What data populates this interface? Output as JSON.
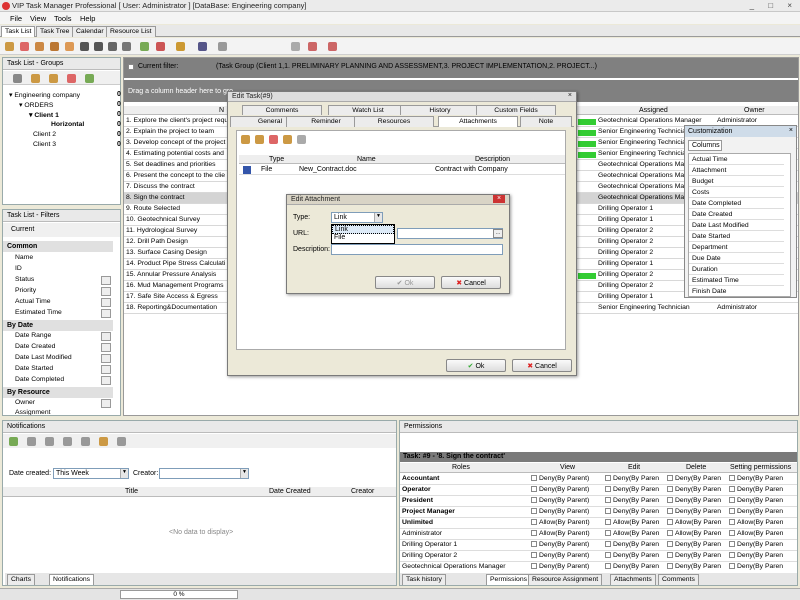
{
  "app": {
    "title": "VIP Task Manager Professional [ User: Administrator ] [DataBase: Engineering company]",
    "win_buttons": "_ □ ×"
  },
  "menu": [
    "File",
    "View",
    "Tools",
    "Help"
  ],
  "tabs": [
    "Task List",
    "Task Tree",
    "Calendar",
    "Resource List"
  ],
  "groups": {
    "title": "Task List - Groups",
    "tree": [
      {
        "label": "Engineering company",
        "count": "0"
      },
      {
        "label": "ORDERS",
        "count": "0"
      },
      {
        "label": "Client 1",
        "count": "0"
      },
      {
        "label": "Horizontal",
        "count": "0"
      },
      {
        "label": "Client 2",
        "count": "0"
      },
      {
        "label": "Client 3",
        "count": "0"
      }
    ]
  },
  "filters": {
    "title": "Task List - Filters",
    "current": "Current",
    "sections": [
      {
        "name": "Common",
        "items": [
          "Name",
          "ID",
          "Status",
          "Priority",
          "Actual Time",
          "Estimated Time"
        ]
      },
      {
        "name": "By Date",
        "items": [
          "Date Range",
          "Date Created",
          "Date Last Modified",
          "Date Started",
          "Date Completed"
        ]
      },
      {
        "name": "By Resource",
        "items": [
          "Owner",
          "Assignment"
        ]
      }
    ]
  },
  "main": {
    "current_filter_label": "Current filter:",
    "current_filter_value": "(Task Group (Client 1,1. PRELIMINARY PLANNING AND ASSESSMENT,3. PROJECT IMPLEMENTATION,2. PROJECT...)",
    "drag_hint": "Drag a column header here to gro",
    "col_name": "N",
    "col_assigned": "Assigned",
    "col_owner": "Owner",
    "rows": [
      {
        "name": "1. Explore the client's project requ",
        "assigned": "Geotechnical Operations Manager",
        "owner": "Administrator"
      },
      {
        "name": "2. Explain the project to team",
        "assigned": "Senior Engineering Technician",
        "owner": "Administrator"
      },
      {
        "name": "3. Develop concept of the project",
        "assigned": "Senior Engineering Technician",
        "owner": "Administrator"
      },
      {
        "name": "4. Estimating potential costs and",
        "assigned": "Senior Engineering Technician",
        "owner": "Administrator"
      },
      {
        "name": "5. Set deadlines and priorities",
        "assigned": "Geotechnical Operations Mana",
        "owner": ""
      },
      {
        "name": "6. Present the concept to the clie",
        "assigned": "Geotechnical Operations Mana",
        "owner": ""
      },
      {
        "name": "7. Discuss the contract",
        "assigned": "Geotechnical Operations Mana",
        "owner": ""
      },
      {
        "name": "8. Sign the contract",
        "assigned": "Geotechnical Operations Mana",
        "owner": ""
      },
      {
        "name": "9. Route Selected",
        "assigned": "Drilling Operator 1",
        "owner": ""
      },
      {
        "name": "10. Geotechnical Survey",
        "assigned": "Drilling Operator 1",
        "owner": ""
      },
      {
        "name": "11. Hydrological Survey",
        "assigned": "Drilling Operator 2",
        "owner": ""
      },
      {
        "name": "12. Drill Path Design",
        "assigned": "Drilling Operator 2",
        "owner": ""
      },
      {
        "name": "13. Surface Casing Design",
        "assigned": "Drilling Operator 2",
        "owner": ""
      },
      {
        "name": "14. Product Pipe Stress Calculati",
        "assigned": "Drilling Operator 1",
        "owner": ""
      },
      {
        "name": "15. Annular Pressure Analysis",
        "assigned": "Drilling Operator 2",
        "owner": ""
      },
      {
        "name": "16. Mud Management Programs",
        "assigned": "Drilling Operator 2",
        "owner": ""
      },
      {
        "name": "17. Safe Site Access & Egress",
        "assigned": "Drilling Operator 1",
        "owner": ""
      },
      {
        "name": "18. Reporting&Documentation",
        "assigned": "Senior Engineering Technician",
        "owner": "Administrator"
      }
    ]
  },
  "edit_task": {
    "title": "Edit Task(#9)",
    "tabs_row1": [
      "Comments",
      "Watch List",
      "History",
      "Custom Fields"
    ],
    "tabs_row2": [
      "General",
      "Reminder",
      "Resources",
      "Attachments",
      "Note"
    ],
    "att_cols": {
      "type": "Type",
      "name": "Name",
      "desc": "Description"
    },
    "attachment": {
      "type": "File",
      "name": "New_Contract.doc",
      "desc": "Contract with Company"
    },
    "ok": "Ok",
    "cancel": "Cancel"
  },
  "edit_attachment": {
    "title": "Edit Attachment",
    "type_label": "Type:",
    "type_value": "Link",
    "options": [
      "Link",
      "File"
    ],
    "url_label": "URL:",
    "desc_label": "Description:",
    "ok": "Ok",
    "cancel": "Cancel"
  },
  "customization": {
    "title": "Customization",
    "tab": "Columns",
    "items": [
      "Actual Time",
      "Attachment",
      "Budget",
      "Costs",
      "Date Completed",
      "Date Created",
      "Date Last Modified",
      "Date Started",
      "Department",
      "Due Date",
      "Duration",
      "Estimated Time",
      "Finish Date"
    ]
  },
  "notifications": {
    "title": "Notifications",
    "date_label": "Date created:",
    "date_value": "This Week",
    "creator_label": "Creator:",
    "col_title": "Title",
    "col_date": "Date Created",
    "col_creator": "Creator",
    "empty": "<No data to display>",
    "tabs": [
      "Charts",
      "Notifications"
    ]
  },
  "permissions": {
    "title": "Permissions",
    "task": "Task: #9 - '8. Sign the contract'",
    "cols": [
      "Roles",
      "View",
      "Edit",
      "Delete",
      "Setting permissions"
    ],
    "rows": [
      {
        "role": "Accountant",
        "bold": true,
        "v": "Deny(By Parent)",
        "e": "Deny(By Paren",
        "d": "Deny(By Paren",
        "s": "Deny(By Paren"
      },
      {
        "role": "Operator",
        "bold": true,
        "v": "Deny(By Parent)",
        "e": "Deny(By Paren",
        "d": "Deny(By Paren",
        "s": "Deny(By Paren"
      },
      {
        "role": "President",
        "bold": true,
        "v": "Deny(By Parent)",
        "e": "Deny(By Paren",
        "d": "Deny(By Paren",
        "s": "Deny(By Paren"
      },
      {
        "role": "Project Manager",
        "bold": true,
        "v": "Deny(By Parent)",
        "e": "Deny(By Paren",
        "d": "Deny(By Paren",
        "s": "Deny(By Paren"
      },
      {
        "role": "Unlimited",
        "bold": true,
        "v": "Allow(By Parent)",
        "e": "Allow(By Paren",
        "d": "Allow(By Paren",
        "s": "Allow(By Paren"
      },
      {
        "role": "Administrator",
        "bold": false,
        "v": "Allow(By Parent)",
        "e": "Allow(By Paren",
        "d": "Allow(By Paren",
        "s": "Allow(By Paren"
      },
      {
        "role": "Drilling Operator 1",
        "bold": false,
        "v": "Deny(By Parent)",
        "e": "Deny(By Paren",
        "d": "Deny(By Paren",
        "s": "Deny(By Paren"
      },
      {
        "role": "Drilling Operator 2",
        "bold": false,
        "v": "Deny(By Parent)",
        "e": "Deny(By Paren",
        "d": "Deny(By Paren",
        "s": "Deny(By Paren"
      },
      {
        "role": "Geotechnical Operations Manager",
        "bold": false,
        "v": "Deny(By Parent)",
        "e": "Deny(By Paren",
        "d": "Deny(By Paren",
        "s": "Deny(By Paren"
      }
    ],
    "tabs": [
      "Task history",
      "Permissions",
      "Resource Assignment",
      "Attachments",
      "Comments"
    ]
  },
  "status": {
    "progress": "0 %"
  }
}
